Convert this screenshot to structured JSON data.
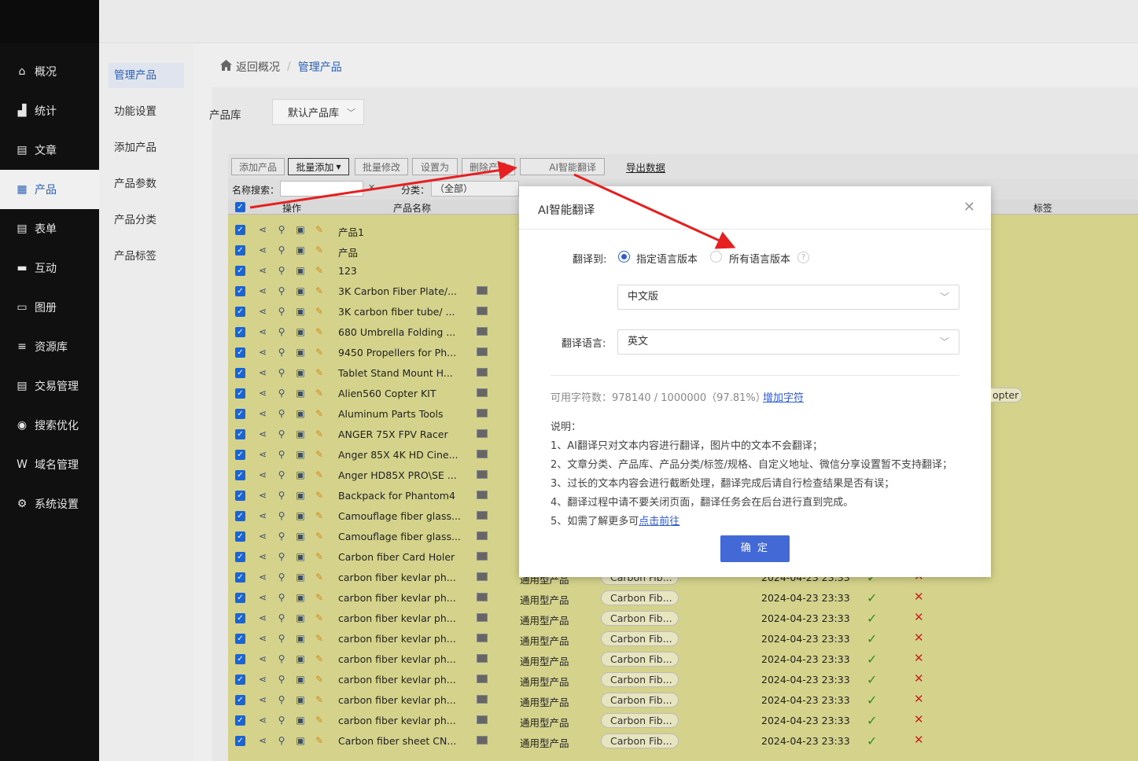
{
  "sidebar": {
    "items": [
      {
        "label": "概况",
        "icon": "home-icon"
      },
      {
        "label": "统计",
        "icon": "stats-icon"
      },
      {
        "label": "文章",
        "icon": "article-icon"
      },
      {
        "label": "产品",
        "icon": "product-icon"
      },
      {
        "label": "表单",
        "icon": "form-icon"
      },
      {
        "label": "互动",
        "icon": "chat-icon"
      },
      {
        "label": "图册",
        "icon": "album-icon"
      },
      {
        "label": "资源库",
        "icon": "database-icon"
      },
      {
        "label": "交易管理",
        "icon": "trade-icon"
      },
      {
        "label": "搜索优化",
        "icon": "seo-icon"
      },
      {
        "label": "域名管理",
        "icon": "domain-icon"
      },
      {
        "label": "系统设置",
        "icon": "gear-icon"
      }
    ]
  },
  "subnav": {
    "items": [
      {
        "label": "管理产品"
      },
      {
        "label": "功能设置"
      },
      {
        "label": "添加产品"
      },
      {
        "label": "产品参数"
      },
      {
        "label": "产品分类"
      },
      {
        "label": "产品标签"
      }
    ]
  },
  "breadcrumb": {
    "home": "返回概况",
    "current": "管理产品"
  },
  "library": {
    "label": "产品库",
    "value": "默认产品库"
  },
  "toolbar": {
    "add": "添加产品",
    "batch_add": "批量添加",
    "batch_edit": "批量修改",
    "set_as": "设置为",
    "delete": "删除产品",
    "ai_translate": "AI智能翻译",
    "export": "导出数据"
  },
  "filter": {
    "name_label": "名称搜索：",
    "category_label": "分类：",
    "category_value": "（全部）"
  },
  "table": {
    "headers": {
      "ops": "操作",
      "name": "产品名称",
      "tags": "标签"
    },
    "rows": [
      {
        "name": "产品1"
      },
      {
        "name": "产品"
      },
      {
        "name": "123"
      },
      {
        "name": "3K Carbon Fiber Plate/...",
        "thumb": true
      },
      {
        "name": "3K carbon fiber tube/ ...",
        "thumb": true
      },
      {
        "name": "680 Umbrella Folding ...",
        "thumb": true
      },
      {
        "name": "9450 Propellers for Ph...",
        "thumb": true
      },
      {
        "name": "Tablet Stand Mount H...",
        "thumb": true
      },
      {
        "name": "Alien560 Copter KIT",
        "thumb": true
      },
      {
        "name": "Aluminum Parts Tools",
        "thumb": true
      },
      {
        "name": "ANGER 75X FPV Racer",
        "thumb": true
      },
      {
        "name": "Anger 85X 4K HD Cine...",
        "thumb": true
      },
      {
        "name": "Anger HD85X PRO\\SE ...",
        "thumb": true
      },
      {
        "name": "Backpack for Phantom4",
        "thumb": true
      },
      {
        "name": "Camouflage fiber glass...",
        "thumb": true
      },
      {
        "name": "Camouflage fiber glass...",
        "thumb": true
      },
      {
        "name": "Carbon fiber Card Holer",
        "thumb": true
      },
      {
        "name": "carbon fiber kevlar ph...",
        "thumb": true,
        "category": "通用型产品",
        "tag": "Carbon Fib...",
        "date": "2024-04-23 23:33"
      },
      {
        "name": "carbon fiber kevlar ph...",
        "thumb": true,
        "category": "通用型产品",
        "tag": "Carbon Fib...",
        "date": "2024-04-23 23:33"
      },
      {
        "name": "carbon fiber kevlar ph...",
        "thumb": true,
        "category": "通用型产品",
        "tag": "Carbon Fib...",
        "date": "2024-04-23 23:33"
      },
      {
        "name": "carbon fiber kevlar ph...",
        "thumb": true,
        "category": "通用型产品",
        "tag": "Carbon Fib...",
        "date": "2024-04-23 23:33"
      },
      {
        "name": "carbon fiber kevlar ph...",
        "thumb": true,
        "category": "通用型产品",
        "tag": "Carbon Fib...",
        "date": "2024-04-23 23:33"
      },
      {
        "name": "carbon fiber kevlar ph...",
        "thumb": true,
        "category": "通用型产品",
        "tag": "Carbon Fib...",
        "date": "2024-04-23 23:33"
      },
      {
        "name": "carbon fiber kevlar ph...",
        "thumb": true,
        "category": "通用型产品",
        "tag": "Carbon Fib...",
        "date": "2024-04-23 23:33"
      },
      {
        "name": "carbon fiber kevlar ph...",
        "thumb": true,
        "category": "通用型产品",
        "tag": "Carbon Fib...",
        "date": "2024-04-23 23:33"
      },
      {
        "name": "Carbon fiber sheet CN...",
        "thumb": true,
        "category": "通用型产品",
        "tag": "Carbon Fib...",
        "date": "2024-04-23 23:33"
      }
    ],
    "partial_tag": "opter"
  },
  "modal": {
    "title": "AI智能翻译",
    "translate_to_label": "翻译到:",
    "option_specified": "指定语言版本",
    "option_all": "所有语言版本",
    "source_version": "中文版",
    "language_label": "翻译语言:",
    "language_value": "英文",
    "quota_text": "可用字符数：978140 / 1000000（97.81%）",
    "quota_link": "增加字符",
    "notes_title": "说明：",
    "notes": [
      "1、AI翻译只对文本内容进行翻译，图片中的文本不会翻译；",
      "2、文章分类、产品库、产品分类/标签/规格、自定义地址、微信分享设置暂不支持翻译；",
      "3、过长的文本内容会进行截断处理，翻译完成后请自行检查结果是否有误；",
      "4、翻译过程中请不要关闭页面，翻译任务会在后台进行直到完成。"
    ],
    "note5_prefix": "5、如需了解更多可",
    "note5_link": "点击前往",
    "confirm": "确 定"
  },
  "colors": {
    "accent": "#2b5fb4",
    "primary_button": "#4369d6",
    "arrow": "#e62020",
    "row_bg": "#d5d38b"
  }
}
